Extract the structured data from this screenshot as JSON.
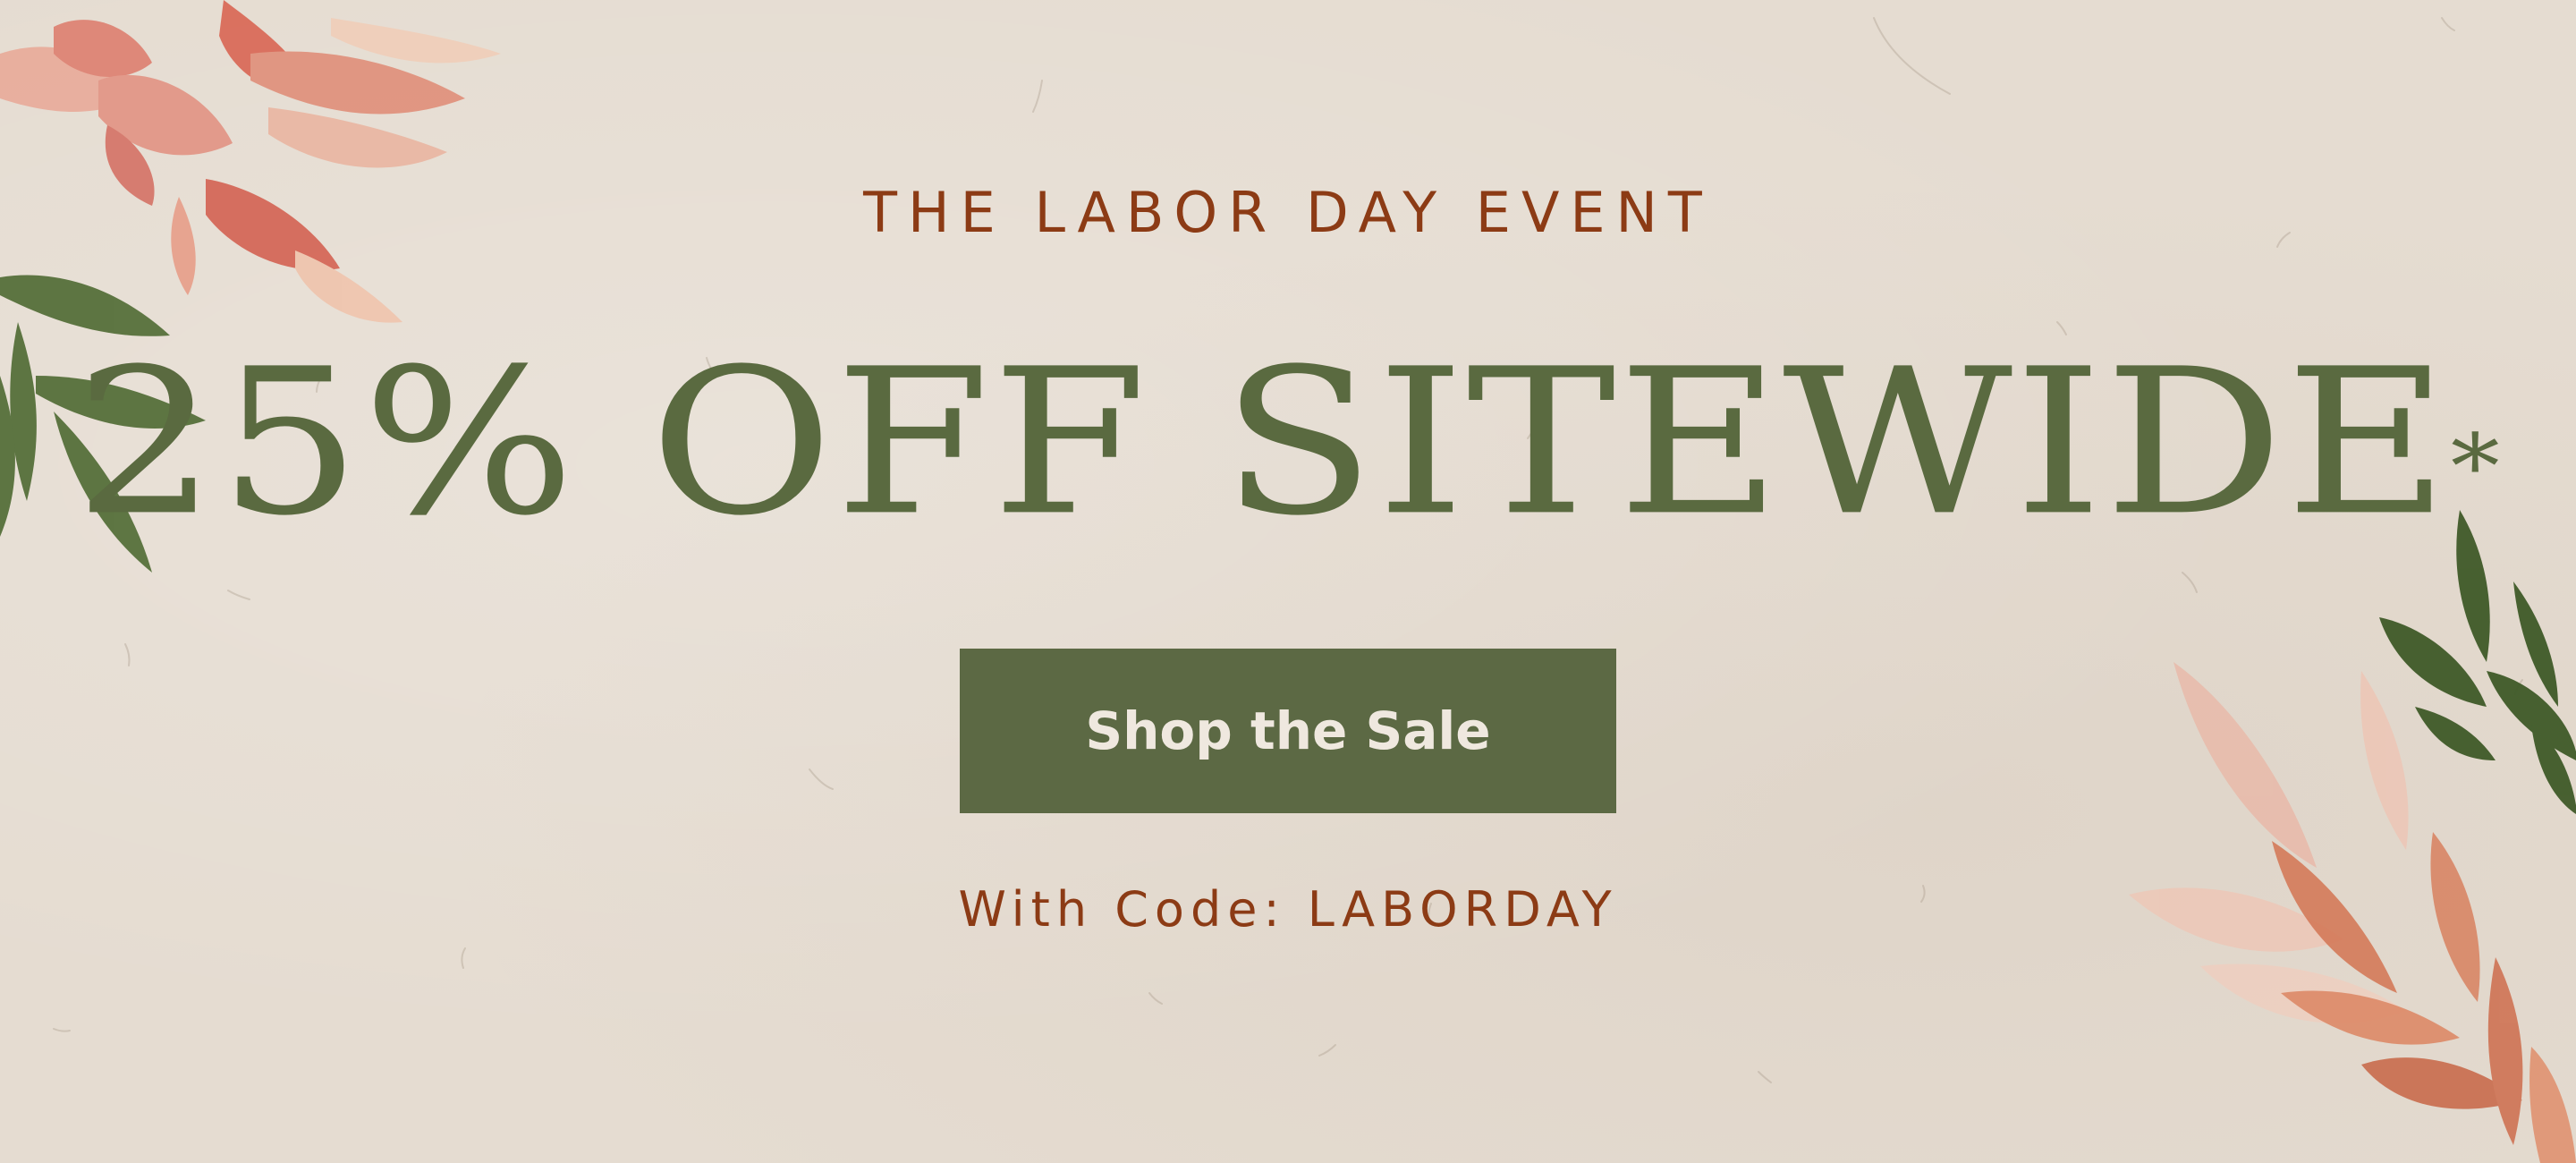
{
  "banner": {
    "eyebrow": "THE LABOR DAY EVENT",
    "headline": "25% OFF SITEWIDE",
    "headline_mark": "*",
    "cta_label": "Shop the Sale",
    "promo_text": "With Code: LABORDAY"
  },
  "colors": {
    "background": "#e5dcd1",
    "accent_text": "#8c3b15",
    "headline_green": "#5a6a40",
    "button_green": "#5c6944",
    "button_text": "#efe8df"
  },
  "decorations": {
    "top_left": "watercolor-floral-icon",
    "bottom_right": "watercolor-leaves-icon"
  }
}
